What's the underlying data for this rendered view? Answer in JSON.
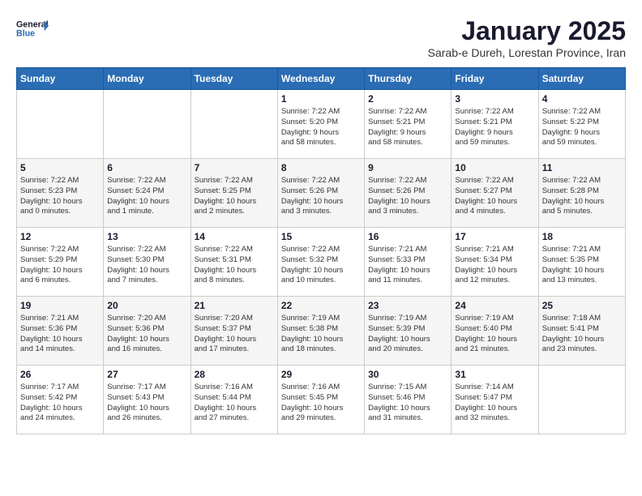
{
  "logo": {
    "line1": "General",
    "line2": "Blue"
  },
  "title": "January 2025",
  "subtitle": "Sarab-e Dureh, Lorestan Province, Iran",
  "days_of_week": [
    "Sunday",
    "Monday",
    "Tuesday",
    "Wednesday",
    "Thursday",
    "Friday",
    "Saturday"
  ],
  "weeks": [
    [
      {
        "day": "",
        "info": ""
      },
      {
        "day": "",
        "info": ""
      },
      {
        "day": "",
        "info": ""
      },
      {
        "day": "1",
        "info": "Sunrise: 7:22 AM\nSunset: 5:20 PM\nDaylight: 9 hours\nand 58 minutes."
      },
      {
        "day": "2",
        "info": "Sunrise: 7:22 AM\nSunset: 5:21 PM\nDaylight: 9 hours\nand 58 minutes."
      },
      {
        "day": "3",
        "info": "Sunrise: 7:22 AM\nSunset: 5:21 PM\nDaylight: 9 hours\nand 59 minutes."
      },
      {
        "day": "4",
        "info": "Sunrise: 7:22 AM\nSunset: 5:22 PM\nDaylight: 9 hours\nand 59 minutes."
      }
    ],
    [
      {
        "day": "5",
        "info": "Sunrise: 7:22 AM\nSunset: 5:23 PM\nDaylight: 10 hours\nand 0 minutes."
      },
      {
        "day": "6",
        "info": "Sunrise: 7:22 AM\nSunset: 5:24 PM\nDaylight: 10 hours\nand 1 minute."
      },
      {
        "day": "7",
        "info": "Sunrise: 7:22 AM\nSunset: 5:25 PM\nDaylight: 10 hours\nand 2 minutes."
      },
      {
        "day": "8",
        "info": "Sunrise: 7:22 AM\nSunset: 5:26 PM\nDaylight: 10 hours\nand 3 minutes."
      },
      {
        "day": "9",
        "info": "Sunrise: 7:22 AM\nSunset: 5:26 PM\nDaylight: 10 hours\nand 3 minutes."
      },
      {
        "day": "10",
        "info": "Sunrise: 7:22 AM\nSunset: 5:27 PM\nDaylight: 10 hours\nand 4 minutes."
      },
      {
        "day": "11",
        "info": "Sunrise: 7:22 AM\nSunset: 5:28 PM\nDaylight: 10 hours\nand 5 minutes."
      }
    ],
    [
      {
        "day": "12",
        "info": "Sunrise: 7:22 AM\nSunset: 5:29 PM\nDaylight: 10 hours\nand 6 minutes."
      },
      {
        "day": "13",
        "info": "Sunrise: 7:22 AM\nSunset: 5:30 PM\nDaylight: 10 hours\nand 7 minutes."
      },
      {
        "day": "14",
        "info": "Sunrise: 7:22 AM\nSunset: 5:31 PM\nDaylight: 10 hours\nand 8 minutes."
      },
      {
        "day": "15",
        "info": "Sunrise: 7:22 AM\nSunset: 5:32 PM\nDaylight: 10 hours\nand 10 minutes."
      },
      {
        "day": "16",
        "info": "Sunrise: 7:21 AM\nSunset: 5:33 PM\nDaylight: 10 hours\nand 11 minutes."
      },
      {
        "day": "17",
        "info": "Sunrise: 7:21 AM\nSunset: 5:34 PM\nDaylight: 10 hours\nand 12 minutes."
      },
      {
        "day": "18",
        "info": "Sunrise: 7:21 AM\nSunset: 5:35 PM\nDaylight: 10 hours\nand 13 minutes."
      }
    ],
    [
      {
        "day": "19",
        "info": "Sunrise: 7:21 AM\nSunset: 5:36 PM\nDaylight: 10 hours\nand 14 minutes."
      },
      {
        "day": "20",
        "info": "Sunrise: 7:20 AM\nSunset: 5:36 PM\nDaylight: 10 hours\nand 16 minutes."
      },
      {
        "day": "21",
        "info": "Sunrise: 7:20 AM\nSunset: 5:37 PM\nDaylight: 10 hours\nand 17 minutes."
      },
      {
        "day": "22",
        "info": "Sunrise: 7:19 AM\nSunset: 5:38 PM\nDaylight: 10 hours\nand 18 minutes."
      },
      {
        "day": "23",
        "info": "Sunrise: 7:19 AM\nSunset: 5:39 PM\nDaylight: 10 hours\nand 20 minutes."
      },
      {
        "day": "24",
        "info": "Sunrise: 7:19 AM\nSunset: 5:40 PM\nDaylight: 10 hours\nand 21 minutes."
      },
      {
        "day": "25",
        "info": "Sunrise: 7:18 AM\nSunset: 5:41 PM\nDaylight: 10 hours\nand 23 minutes."
      }
    ],
    [
      {
        "day": "26",
        "info": "Sunrise: 7:17 AM\nSunset: 5:42 PM\nDaylight: 10 hours\nand 24 minutes."
      },
      {
        "day": "27",
        "info": "Sunrise: 7:17 AM\nSunset: 5:43 PM\nDaylight: 10 hours\nand 26 minutes."
      },
      {
        "day": "28",
        "info": "Sunrise: 7:16 AM\nSunset: 5:44 PM\nDaylight: 10 hours\nand 27 minutes."
      },
      {
        "day": "29",
        "info": "Sunrise: 7:16 AM\nSunset: 5:45 PM\nDaylight: 10 hours\nand 29 minutes."
      },
      {
        "day": "30",
        "info": "Sunrise: 7:15 AM\nSunset: 5:46 PM\nDaylight: 10 hours\nand 31 minutes."
      },
      {
        "day": "31",
        "info": "Sunrise: 7:14 AM\nSunset: 5:47 PM\nDaylight: 10 hours\nand 32 minutes."
      },
      {
        "day": "",
        "info": ""
      }
    ]
  ]
}
